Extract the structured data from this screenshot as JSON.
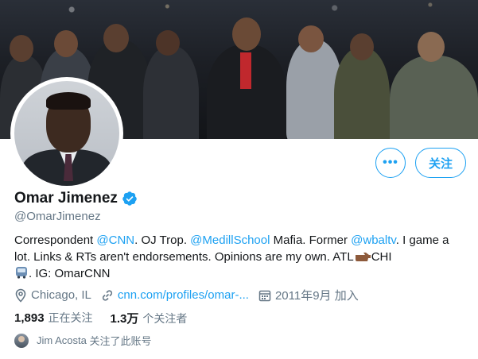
{
  "profile": {
    "name": "Omar Jimenez",
    "handle": "@OmarJimenez",
    "bio": {
      "p1": "Correspondent ",
      "link1": "@CNN",
      "p2": ". OJ Trop. ",
      "link2": "@MedillSchool",
      "p3": " Mafia. Former ",
      "link3": "@wbaltv",
      "p4": ". I game a lot. Links & RTs aren't endorsements. Opinions are my own. ATL",
      "p5": "CHI",
      "p6": ". IG: OmarCNN"
    },
    "location": "Chicago, IL",
    "website": "cnn.com/profiles/omar-...",
    "joined_date": "2011年9月",
    "joined_suffix": "加入"
  },
  "actions": {
    "more_label": "•••",
    "follow_label": "关注"
  },
  "stats": {
    "following_count": "1,893",
    "following_label": "正在关注",
    "followers_count": "1.3万",
    "followers_label": "个关注者"
  },
  "followed_by": {
    "name": "Jim Acosta",
    "suffix": "关注了此账号"
  },
  "colors": {
    "accent": "#1da1f2",
    "secondary_text": "#657786"
  },
  "icons": [
    "verified-icon",
    "location-icon",
    "link-icon",
    "calendar-icon",
    "pointing-right-icon",
    "bus-icon"
  ]
}
